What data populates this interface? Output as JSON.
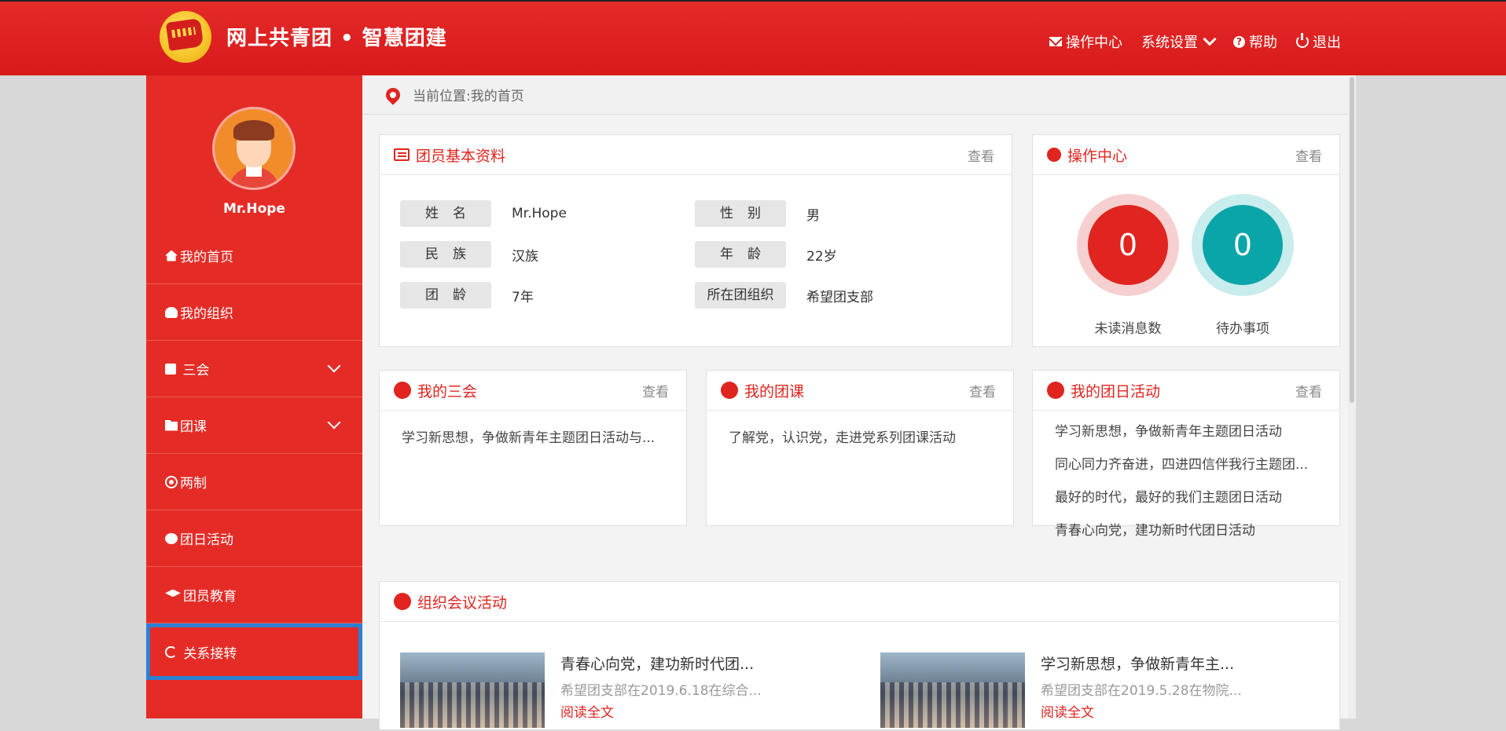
{
  "header": {
    "title": "网上共青团 • 智慧团建",
    "nav": [
      {
        "label": "操作中心",
        "icon": "mail-icon"
      },
      {
        "label": "系统设置",
        "icon": "chevron-down-icon"
      },
      {
        "label": "帮助",
        "icon": "help-icon"
      },
      {
        "label": "退出",
        "icon": "power-icon"
      }
    ]
  },
  "sidebar": {
    "username": "Mr.Hope",
    "items": [
      {
        "label": "我的首页",
        "icon": "home-icon"
      },
      {
        "label": "我的组织",
        "icon": "users-icon"
      },
      {
        "label": "三会",
        "icon": "edit-icon",
        "expandable": true
      },
      {
        "label": "团课",
        "icon": "folder-open-icon",
        "expandable": true
      },
      {
        "label": "两制",
        "icon": "target-icon"
      },
      {
        "label": "团日活动",
        "icon": "recycle-icon"
      },
      {
        "label": "团员教育",
        "icon": "graduation-cap-icon"
      },
      {
        "label": "关系接转",
        "icon": "refresh-icon",
        "selected": true
      }
    ]
  },
  "breadcrumb": "当前位置:我的首页",
  "profile": {
    "title": "团员基本资料",
    "view": "查看",
    "fields": [
      {
        "label": "姓名",
        "value": "Mr.Hope"
      },
      {
        "label": "性别",
        "value": "男"
      },
      {
        "label": "民族",
        "value": "汉族"
      },
      {
        "label": "年龄",
        "value": "22岁"
      },
      {
        "label": "团龄",
        "value": "7年"
      },
      {
        "label": "所在团组织",
        "value": "希望团支部"
      }
    ]
  },
  "operation": {
    "title": "操作中心",
    "view": "查看",
    "unread": {
      "count": "0",
      "label": "未读消息数",
      "color": "#e0241f"
    },
    "todo": {
      "count": "0",
      "label": "待办事项",
      "color": "#0aa5a8"
    }
  },
  "sanhui": {
    "title": "我的三会",
    "view": "查看",
    "items": [
      "学习新思想，争做新青年主题团日活动与..."
    ]
  },
  "tuanke": {
    "title": "我的团课",
    "view": "查看",
    "items": [
      "了解党，认识党，走进党系列团课活动"
    ]
  },
  "tuanri": {
    "title": "我的团日活动",
    "view": "查看",
    "items": [
      "学习新思想，争做新青年主题团日活动",
      "同心同力齐奋进，四进四信伴我行主题团...",
      "最好的时代，最好的我们主题团日活动",
      "青春心向党，建功新时代团日活动"
    ]
  },
  "meetings": {
    "title": "组织会议活动",
    "items": [
      {
        "title": "青春心向党，建功新时代团...",
        "sub": "希望团支部在2019.6.18在综合...",
        "more": "阅读全文"
      },
      {
        "title": "学习新思想，争做新青年主...",
        "sub": "希望团支部在2019.5.28在物院...",
        "more": "阅读全文"
      }
    ]
  },
  "colors": {
    "brand": "#e0241f",
    "sidebar": "#e52b26",
    "teal": "#0aa5a8",
    "selection": "#2d7fd3"
  }
}
